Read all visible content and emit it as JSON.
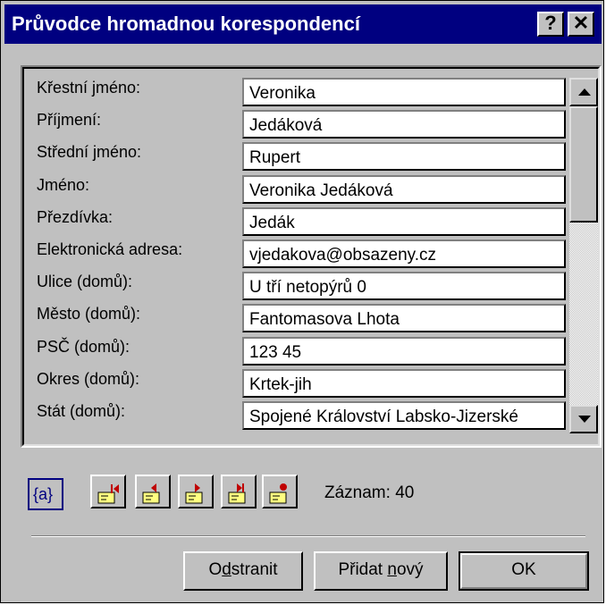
{
  "window": {
    "title": "Průvodce hromadnou korespondencí",
    "help_label": "?",
    "close_label": "✕"
  },
  "fields": [
    {
      "label": "Křestní jméno:",
      "value": "Veronika"
    },
    {
      "label": "Příjmení:",
      "value": "Jedáková"
    },
    {
      "label": "Střední jméno:",
      "value": "Rupert"
    },
    {
      "label": "Jméno:",
      "value": "Veronika Jedáková"
    },
    {
      "label": "Přezdívka:",
      "value": "Jedák"
    },
    {
      "label": "Elektronická adresa:",
      "value": "vjedakova@obsazeny.cz"
    },
    {
      "label": "Ulice (domů):",
      "value": "U tří netopýrů 0"
    },
    {
      "label": "Město (domů):",
      "value": "Fantomasova Lhota"
    },
    {
      "label": "PSČ (domů):",
      "value": "123 45"
    },
    {
      "label": "Okres (domů):",
      "value": "Krtek-jih"
    },
    {
      "label": "Stát (domů):",
      "value": "Spojené Království Labsko-Jizerské"
    }
  ],
  "navigation": {
    "field_codes_label": "{a}",
    "record_label": "Záznam: 40"
  },
  "buttons": {
    "delete_pre": "O",
    "delete_key": "d",
    "delete_post": "stranit",
    "add_pre": "Přidat ",
    "add_key": "n",
    "add_post": "ový",
    "ok_label": "OK"
  },
  "colors": {
    "titlebar": "#000080",
    "dialog": "#c0c0c0"
  }
}
